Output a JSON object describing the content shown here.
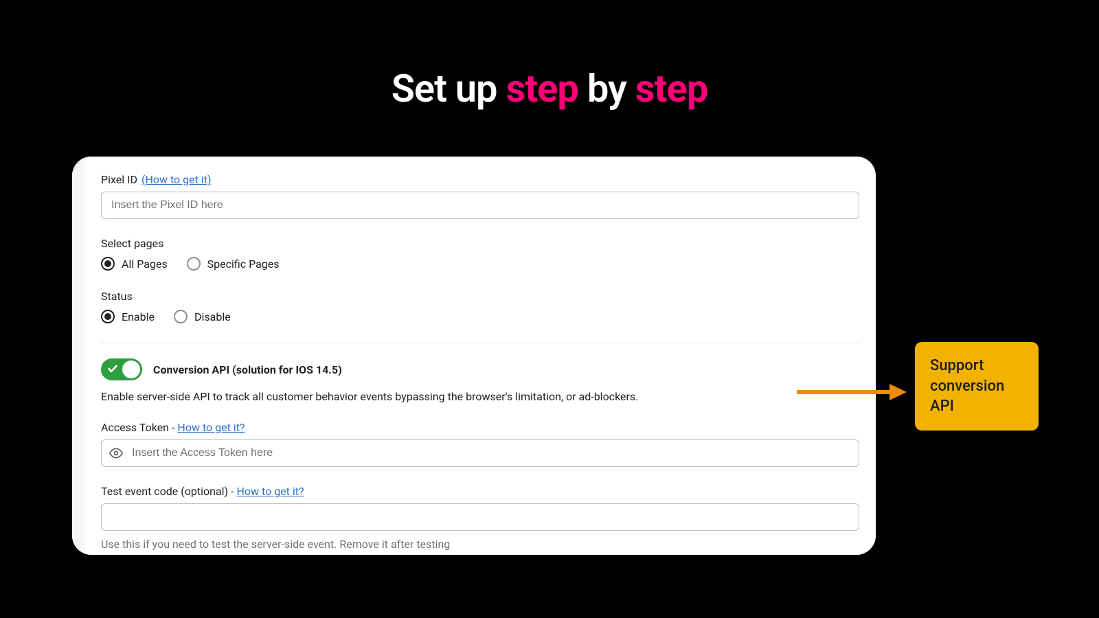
{
  "headline": {
    "part1": "Set up ",
    "pink1": "step",
    "part2": " by ",
    "pink2": "step"
  },
  "form": {
    "pixel_id_label": "Pixel ID",
    "pixel_id_help_link": "(How to get it)",
    "pixel_id_placeholder": "Insert the Pixel ID here",
    "select_pages_label": "Select pages",
    "pages_option_all": "All Pages",
    "pages_option_specific": "Specific Pages",
    "status_label": "Status",
    "status_enable": "Enable",
    "status_disable": "Disable",
    "conversion_api_title": "Conversion API (solution for IOS 14.5)",
    "conversion_api_desc": "Enable server-side API to track all customer behavior events bypassing the browser's limitation, or ad-blockers.",
    "access_token_label": "Access Token - ",
    "access_token_help": "How to get it?",
    "access_token_placeholder": "Insert the Access Token here",
    "test_event_label": "Test event code (optional) - ",
    "test_event_help": "How to get it?",
    "test_event_helper": "Use this if you need to test the server-side event. Remove it after testing"
  },
  "callout": {
    "text": "Support conversion API"
  },
  "colors": {
    "pink": "#ff0078",
    "callout_bg": "#f2b200",
    "arrow": "#ef8a0a",
    "toggle_on": "#2e9e3f"
  }
}
